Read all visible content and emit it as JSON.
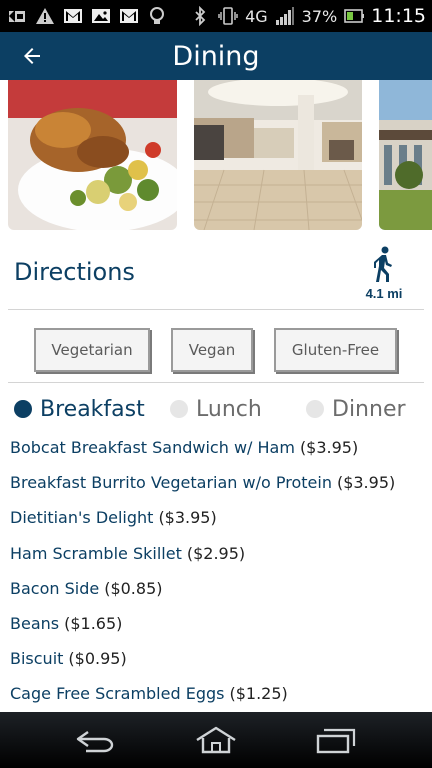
{
  "status_bar": {
    "battery_percent": "37%",
    "time": "11:15",
    "network": "4G",
    "icons": [
      "screenshot-icon",
      "warning-icon",
      "gmail-icon",
      "gallery-icon",
      "gmail-icon",
      "lightbulb-icon",
      "bluetooth-icon",
      "vibrate-icon",
      "signal-icon",
      "battery-icon"
    ]
  },
  "header": {
    "title": "Dining",
    "back_icon": "arrow-left-icon"
  },
  "photos": [
    "roast-chicken-plate-photo",
    "cafeteria-interior-photo",
    "building-exterior-photo"
  ],
  "directions": {
    "label": "Directions",
    "distance": "4.1 mi",
    "icon": "walking-person-icon"
  },
  "filters": [
    "Vegetarian",
    "Vegan",
    "Gluten-Free"
  ],
  "meals": [
    {
      "label": "Breakfast",
      "selected": true
    },
    {
      "label": "Lunch",
      "selected": false
    },
    {
      "label": "Dinner",
      "selected": false
    }
  ],
  "menu_items": [
    {
      "name": "Bobcat Breakfast Sandwich w/ Ham",
      "price": "($3.95)"
    },
    {
      "name": "Breakfast Burrito Vegetarian w/o Protein",
      "price": "($3.95)"
    },
    {
      "name": "Dietitian's Delight",
      "price": "($3.95)"
    },
    {
      "name": "Ham Scramble Skillet",
      "price": "($2.95)"
    },
    {
      "name": "Bacon Side",
      "price": "($0.85)"
    },
    {
      "name": "Beans",
      "price": "($1.65)"
    },
    {
      "name": "Biscuit",
      "price": "($0.95)"
    },
    {
      "name": "Cage Free Scrambled Eggs",
      "price": "($1.25)"
    }
  ],
  "nav": [
    "back-nav-icon",
    "home-nav-icon",
    "recent-apps-icon"
  ],
  "colors": {
    "primary": "#0c3f63",
    "status_bar": "#000000",
    "divider": "#d4d4d4"
  }
}
